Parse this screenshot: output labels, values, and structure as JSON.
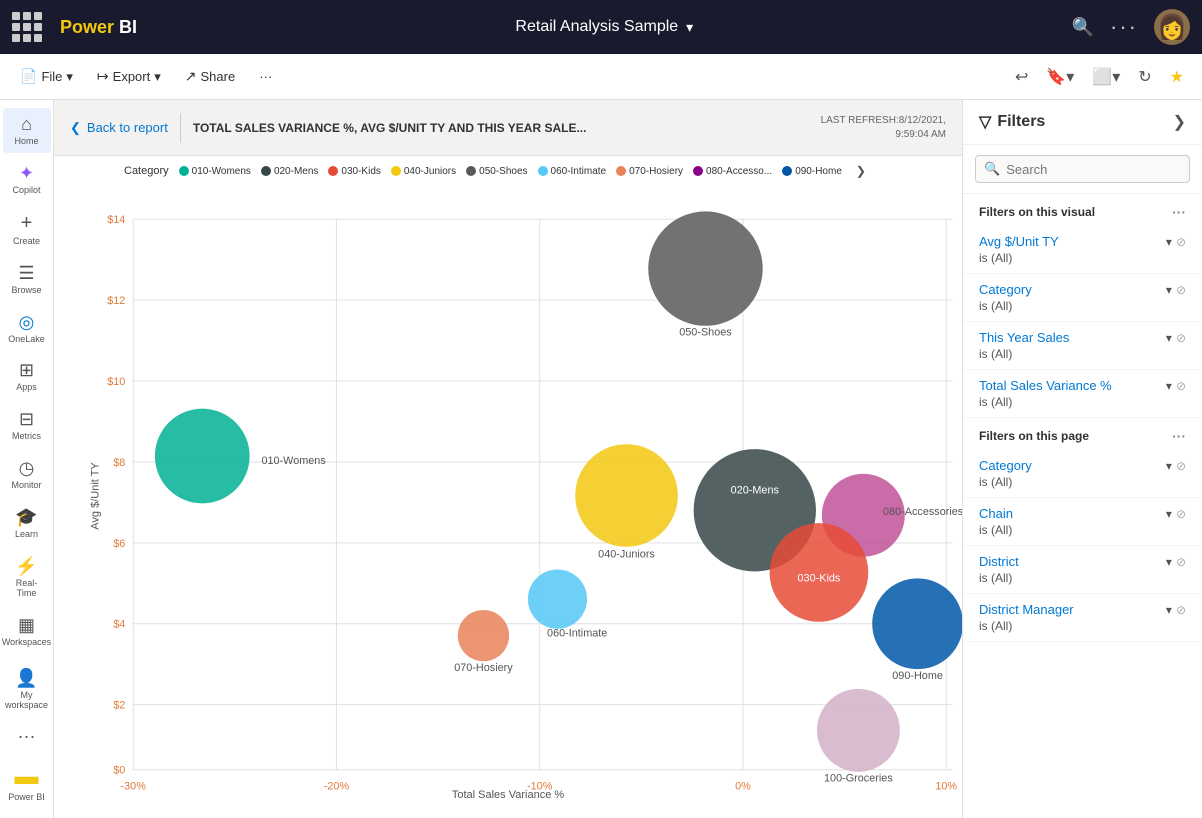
{
  "topNav": {
    "appName": "Power BI",
    "title": "Retail Analysis Sample",
    "chevron": "▾",
    "searchIcon": "🔍",
    "moreIcon": "···",
    "avatarEmoji": "👩‍🦳"
  },
  "toolbar": {
    "fileLabel": "File",
    "exportLabel": "Export",
    "shareLabel": "Share",
    "moreIcon": "···"
  },
  "reportHeader": {
    "backLabel": "Back to report",
    "titleText": "TOTAL SALES VARIANCE %, AVG $/UNIT TY AND THIS YEAR SALE...",
    "lastRefresh": "LAST REFRESH:8/12/2021,",
    "lastRefreshTime": "9:59:04 AM"
  },
  "categoryLegend": {
    "categoryLabel": "Category",
    "items": [
      {
        "id": "010-Womens",
        "label": "010-Womens",
        "color": "#00b294"
      },
      {
        "id": "020-Mens",
        "label": "020-Mens",
        "color": "#374649"
      },
      {
        "id": "030-Kids",
        "label": "030-Kids",
        "color": "#e64b37"
      },
      {
        "id": "040-Juniors",
        "label": "040-Juniors",
        "color": "#f2c811"
      },
      {
        "id": "050-Shoes",
        "label": "050-Shoes",
        "color": "#595959"
      },
      {
        "id": "060-Intimate",
        "label": "060-Intimate",
        "color": "#55c8f4"
      },
      {
        "id": "070-Hosiery",
        "label": "070-Hosiery",
        "color": "#e8825a"
      },
      {
        "id": "080-Accesso...",
        "label": "080-Accesso...",
        "color": "#8b008b"
      },
      {
        "id": "090-Home",
        "label": "090-Home",
        "color": "#0057a8"
      }
    ]
  },
  "chart": {
    "yAxisLabel": "Avg $/Unit TY",
    "xAxisLabel": "Total Sales Variance %",
    "yTicks": [
      "$14",
      "$12",
      "$10",
      "$8",
      "$6",
      "$4",
      "$2",
      "$0"
    ],
    "xTicks": [
      "-30%",
      "-20%",
      "-10%",
      "0%",
      "10%"
    ],
    "bubbles": [
      {
        "id": "050-Shoes",
        "label": "050-Shoes",
        "cx": 680,
        "cy": 85,
        "r": 55,
        "color": "#595959"
      },
      {
        "id": "010-Womens",
        "label": "010-Womens",
        "cx": 125,
        "cy": 265,
        "r": 45,
        "color": "#00b294"
      },
      {
        "id": "040-Juniors",
        "label": "040-Juniors",
        "cx": 555,
        "cy": 305,
        "r": 55,
        "color": "#f2c811"
      },
      {
        "id": "020-Mens",
        "label": "020-Mens",
        "cx": 685,
        "cy": 320,
        "r": 60,
        "color": "#374649"
      },
      {
        "id": "080-Accessories",
        "label": "080-Accessories",
        "cx": 795,
        "cy": 325,
        "r": 45,
        "color": "#c05299"
      },
      {
        "id": "090-Home",
        "label": "090-Home",
        "cx": 860,
        "cy": 435,
        "r": 45,
        "color": "#0057a8"
      },
      {
        "id": "030-Kids",
        "label": "030-Kids",
        "cx": 745,
        "cy": 380,
        "r": 50,
        "color": "#e64b37"
      },
      {
        "id": "060-Intimate",
        "label": "060-Intimate",
        "cx": 490,
        "cy": 415,
        "r": 32,
        "color": "#55c8f4"
      },
      {
        "id": "070-Hosiery",
        "label": "070-Hosiery",
        "cx": 415,
        "cy": 450,
        "r": 28,
        "color": "#e8825a"
      },
      {
        "id": "100-Groceries",
        "label": "100-Groceries",
        "cx": 795,
        "cy": 560,
        "r": 40,
        "color": "#d4b0c8"
      }
    ]
  },
  "filtersPanel": {
    "title": "Filters",
    "searchPlaceholder": "Search",
    "filtersOnVisual": {
      "sectionTitle": "Filters on this visual",
      "items": [
        {
          "name": "Avg $/Unit TY",
          "value": "is (All)"
        },
        {
          "name": "Category",
          "value": "is (All)"
        },
        {
          "name": "This Year Sales",
          "value": "is (All)"
        },
        {
          "name": "Total Sales Variance %",
          "value": "is (All)"
        }
      ]
    },
    "filtersOnPage": {
      "sectionTitle": "Filters on this page",
      "items": [
        {
          "name": "Category",
          "value": "is (All)"
        },
        {
          "name": "Chain",
          "value": "is (All)"
        },
        {
          "name": "District",
          "value": "is (All)"
        },
        {
          "name": "District Manager",
          "value": "is (All)"
        }
      ]
    }
  },
  "sidebar": {
    "items": [
      {
        "id": "home",
        "label": "Home",
        "icon": "⌂",
        "active": true
      },
      {
        "id": "copilot",
        "label": "Copilot",
        "icon": "✦"
      },
      {
        "id": "create",
        "label": "Create",
        "icon": "+"
      },
      {
        "id": "browse",
        "label": "Browse",
        "icon": "☰"
      },
      {
        "id": "onelake",
        "label": "OneLake",
        "icon": "◎"
      },
      {
        "id": "apps",
        "label": "Apps",
        "icon": "⊞"
      },
      {
        "id": "metrics",
        "label": "Metrics",
        "icon": "⊟"
      },
      {
        "id": "monitor",
        "label": "Monitor",
        "icon": "◷"
      },
      {
        "id": "learn",
        "label": "Learn",
        "icon": "🎓"
      },
      {
        "id": "realtime",
        "label": "Real-Time",
        "icon": "⚡"
      },
      {
        "id": "workspaces",
        "label": "Workspaces",
        "icon": "▦"
      }
    ],
    "bottomItems": [
      {
        "id": "my-workspace",
        "label": "My workspace",
        "icon": "👤"
      },
      {
        "id": "more",
        "label": "...",
        "icon": "···"
      },
      {
        "id": "powerbi",
        "label": "Power BI",
        "icon": "📊"
      }
    ]
  }
}
